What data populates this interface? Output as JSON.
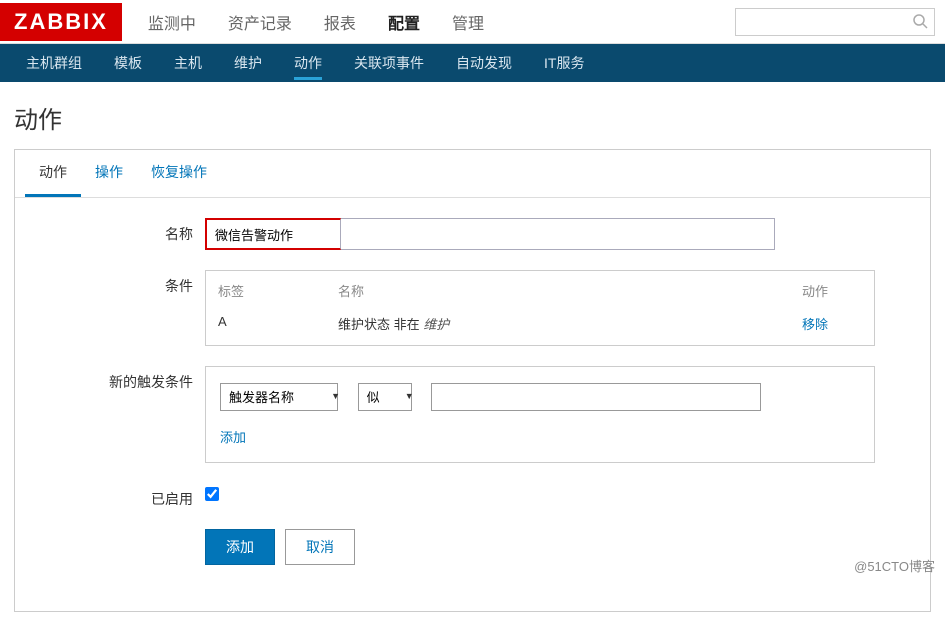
{
  "logo": "ZABBIX",
  "top_menu": {
    "items": [
      "监测中",
      "资产记录",
      "报表",
      "配置",
      "管理"
    ],
    "active_index": 3
  },
  "sub_nav": {
    "items": [
      "主机群组",
      "模板",
      "主机",
      "维护",
      "动作",
      "关联项事件",
      "自动发现",
      "IT服务"
    ],
    "active_index": 4
  },
  "page_title": "动作",
  "tabs": {
    "items": [
      "动作",
      "操作",
      "恢复操作"
    ],
    "active_index": 0
  },
  "form": {
    "name_label": "名称",
    "name_value": "微信告警动作",
    "condition_label": "条件",
    "condition_headers": {
      "tag": "标签",
      "name": "名称",
      "action": "动作"
    },
    "condition_row": {
      "tag": "A",
      "name_prefix": "维护状态 非在 ",
      "name_italic": "维护",
      "action": "移除"
    },
    "trigger_label": "新的触发条件",
    "trigger_type": "触发器名称",
    "trigger_op": "似",
    "trigger_value": "",
    "add_link": "添加",
    "enabled_label": "已启用",
    "enabled": true,
    "submit": "添加",
    "cancel": "取消"
  },
  "watermark": "@51CTO博客"
}
